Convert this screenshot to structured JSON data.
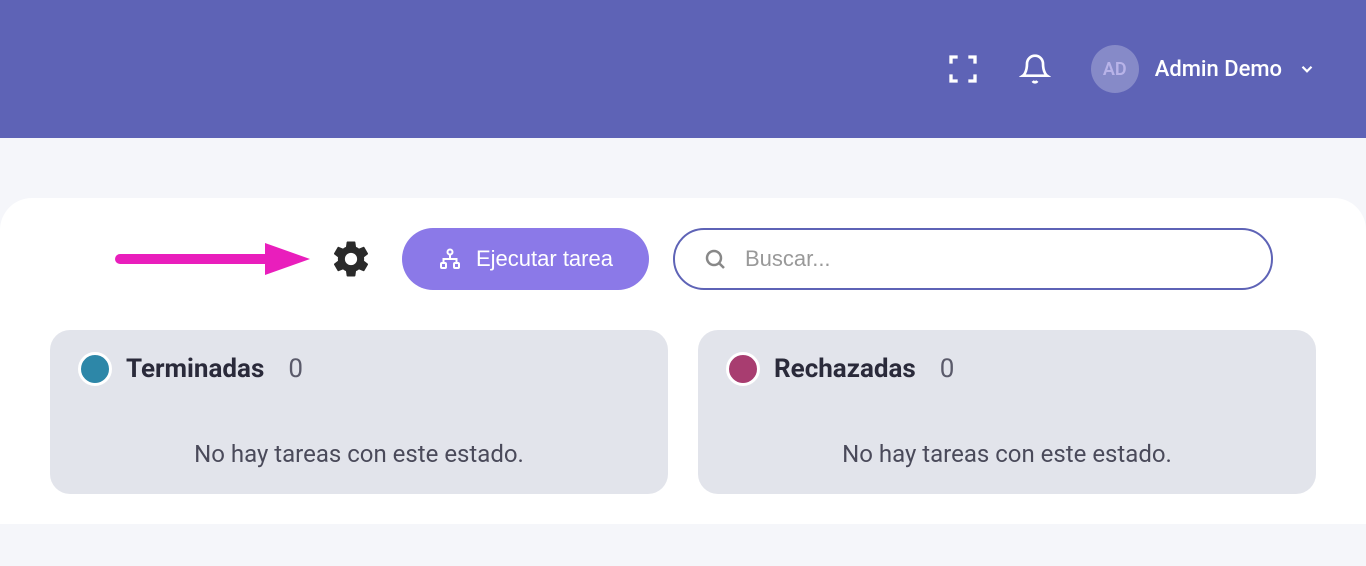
{
  "header": {
    "user_initials": "AD",
    "user_name": "Admin Demo"
  },
  "toolbar": {
    "run_task_label": "Ejecutar tarea",
    "search_placeholder": "Buscar..."
  },
  "columns": [
    {
      "title": "Terminadas",
      "count": "0",
      "dot_color": "dot-blue",
      "empty_message": "No hay tareas con este estado."
    },
    {
      "title": "Rechazadas",
      "count": "0",
      "dot_color": "dot-pink",
      "empty_message": "No hay tareas con este estado."
    }
  ]
}
